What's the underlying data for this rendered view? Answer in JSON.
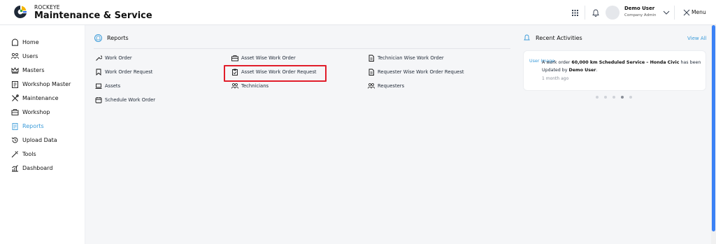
{
  "brand": {
    "top": "ROCKEYE",
    "main": "Maintenance & Service"
  },
  "header": {
    "user_name": "Demo User",
    "user_role": "Company Admin",
    "menu_label": "Menu",
    "icons": [
      "apps-grid-icon",
      "bell-icon",
      "chevron-down-icon",
      "close-icon"
    ]
  },
  "sidebar": {
    "items": [
      {
        "label": "Home",
        "icon": "home-icon"
      },
      {
        "label": "Users",
        "icon": "users-icon"
      },
      {
        "label": "Masters",
        "icon": "crown-icon"
      },
      {
        "label": "Workshop Master",
        "icon": "clipboard-icon"
      },
      {
        "label": "Maintenance",
        "icon": "tools-icon"
      },
      {
        "label": "Workshop",
        "icon": "toolbox-icon"
      },
      {
        "label": "Reports",
        "icon": "report-icon",
        "active": true
      },
      {
        "label": "Upload Data",
        "icon": "history-icon"
      },
      {
        "label": "Tools",
        "icon": "wand-icon"
      },
      {
        "label": "Dashboard",
        "icon": "chart-icon"
      }
    ],
    "active_color": "#3b9bd9"
  },
  "reports": {
    "title": "Reports",
    "links": [
      {
        "label": "Work Order",
        "icon": "wrench-icon"
      },
      {
        "label": "Work Order Request",
        "icon": "bookmark-icon"
      },
      {
        "label": "Assets",
        "icon": "laptop-icon"
      },
      {
        "label": "Schedule Work Order",
        "icon": "calendar-icon"
      },
      {
        "label": "Asset Wise Work Order",
        "icon": "toolbox-icon"
      },
      {
        "label": "Asset Wise Work Order Request",
        "icon": "clipboard-check-icon",
        "highlighted": true
      },
      {
        "label": "Technicians",
        "icon": "users-icon"
      },
      {
        "label": "Technician Wise Work Order",
        "icon": "document-icon"
      },
      {
        "label": "Requester Wise Work Order Request",
        "icon": "document-icon"
      },
      {
        "label": "Requesters",
        "icon": "users-icon"
      }
    ],
    "highlight_color": "#e11d2a"
  },
  "recent_activities": {
    "title": "Recent Activities",
    "view_all": "View All",
    "card": {
      "image_alt": "User Image",
      "text_prefix": "A work order ",
      "text_bold_1": "60,000 km Scheduled Service – Honda Civic",
      "text_mid": " has been Updated by ",
      "text_bold_2": "Demo User",
      "text_suffix": ".",
      "time": "1 month ago"
    },
    "carousel_dots": 5,
    "carousel_active_index": 3
  }
}
